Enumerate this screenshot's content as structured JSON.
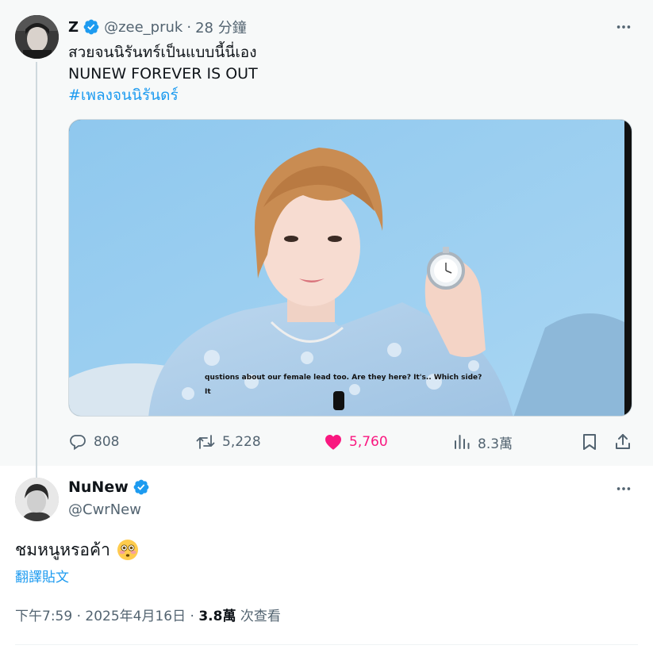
{
  "parent_tweet": {
    "display_name": "Z",
    "handle": "@zee_pruk",
    "separator": "·",
    "time_ago": "28 分鐘",
    "text_line1": "สวยจนนิรันทร์เป็นแบบนี้นี่เอง",
    "text_line2": "NUNEW FOREVER IS OUT",
    "hashtag": "#เพลงจนนิรันดร์",
    "video_caption_line1": "qustions about our female lead too. Are they here? It's.. Which side?",
    "video_caption_line2": "It",
    "actions": {
      "replies": "808",
      "reposts": "5,228",
      "likes": "5,760",
      "views": "8.3萬"
    }
  },
  "main_tweet": {
    "display_name": "NuNew",
    "handle": "@CwrNew",
    "text": "ชมหนูหรอค้า",
    "translate_label": "翻譯貼文",
    "time": "下午7:59",
    "separator": "·",
    "date": "2025年4月16日",
    "separator2": "·",
    "view_count": "3.8萬",
    "view_label": "次查看"
  },
  "icons": {
    "verified": "verified-badge-icon",
    "more": "more-dots-icon",
    "reply": "reply-icon",
    "repost": "repost-icon",
    "like": "heart-icon",
    "views": "views-chart-icon",
    "bookmark": "bookmark-icon",
    "share": "share-icon",
    "emoji": "flushed-face-emoji"
  },
  "colors": {
    "accent": "#1d9bf0",
    "like": "#f91880",
    "muted": "#536471",
    "text": "#0f1419",
    "parent_bg": "#f7f9f9"
  }
}
